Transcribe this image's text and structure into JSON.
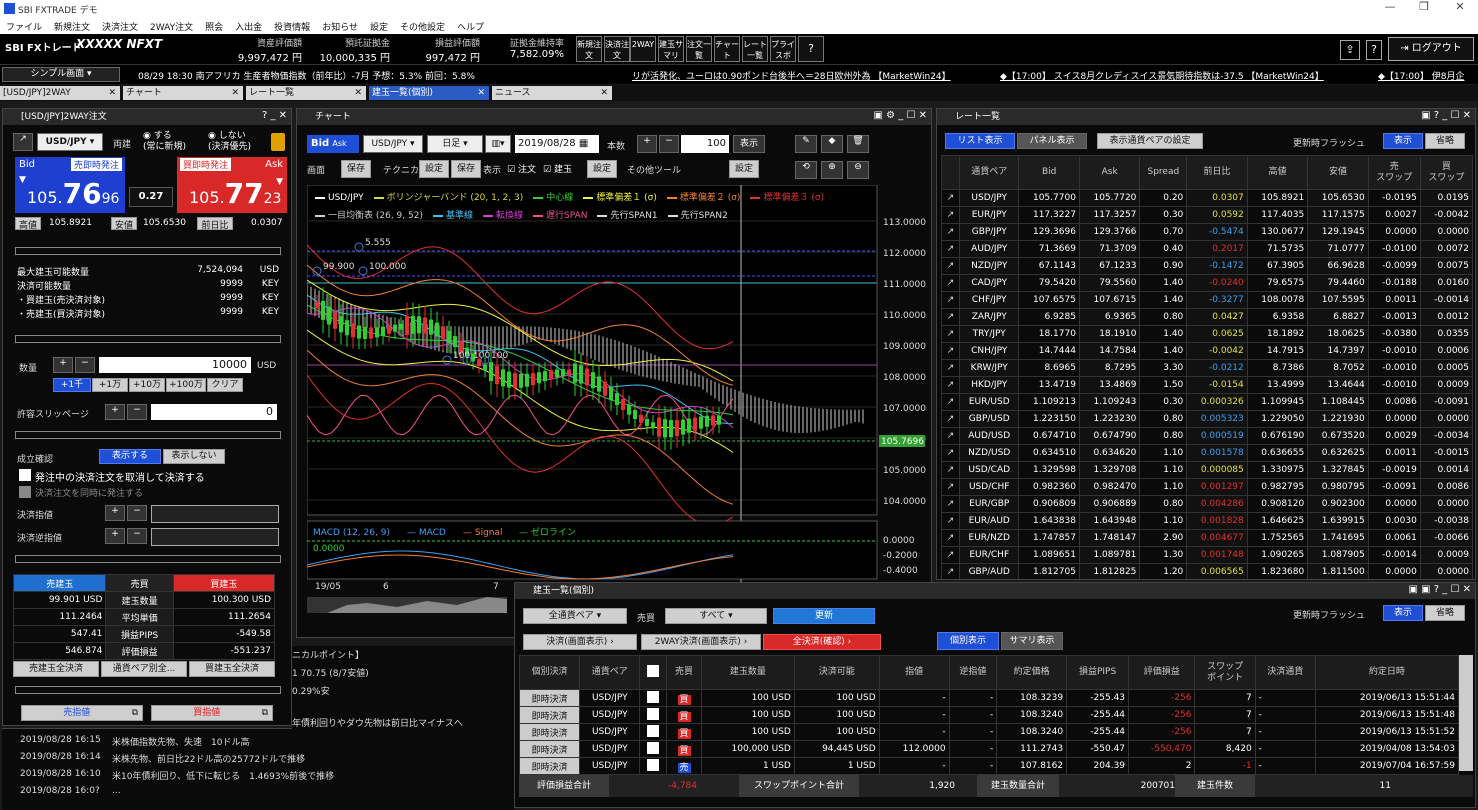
{
  "window": {
    "title": "SBI FXTRADE デモ",
    "min": "—",
    "max": "❐",
    "close": "✕"
  },
  "menu": [
    "ファイル",
    "新規注文",
    "決済注文",
    "2WAY注文",
    "照会",
    "入出金",
    "投資情報",
    "お知らせ",
    "設定",
    "その他設定",
    "ヘルプ"
  ],
  "header": {
    "logo": "SBI FXトレード",
    "account": "XXXXX NFXT",
    "stats": [
      {
        "k": "資産評価額",
        "v": "9,997,472 円"
      },
      {
        "k": "預託証拠金",
        "v": "10,000,335 円"
      },
      {
        "k": "損益評価額",
        "v": "997,472 円"
      },
      {
        "k": "証拠金維持率",
        "v": "7,582.09%"
      }
    ],
    "buttons": [
      "新規注文",
      "決済注文",
      "2WAY",
      "建玉サマリ",
      "注文一覧",
      "チャート",
      "レート一覧",
      "プライスボ",
      "?"
    ],
    "logout": "ログアウト"
  },
  "ticker": {
    "select": "シンプル画面",
    "item1": "08/29 18:30 南アフリカ 生産者物価指数（前年比）-7月 予想：5.3% 前回：5.8%",
    "item2": "リが活発化、ユーロは0.90ポンド台後半へ＝28日欧州外為 【MarketWin24】",
    "item3": "◆【17:00】 スイス8月クレディスイス景気期待指数は-37.5 【MarketWin24】",
    "item4": "◆【17:00】 伊8月企"
  },
  "tabs": [
    "[USD/JPY]2WAY",
    "チャート",
    "レート一覧",
    "建玉一覧(個別)",
    "ニュース"
  ],
  "order": {
    "title": "[USD/JPY]2WAY注文",
    "pair": "USD/JPY",
    "ryodate": "両建",
    "r1": "する\n(常に新規)",
    "r2": "しない\n(決済優先)",
    "bid_label": "Bid",
    "bid_btn": "売即時発注",
    "bid_big": "105.",
    "bid_mid": "76",
    "bid_small": "96",
    "ask_label": "Ask",
    "ask_btn": "買即時発注",
    "ask_big": "105.",
    "ask_mid": "77",
    "ask_small": "23",
    "spread": "0.27",
    "high_l": "高値",
    "high_v": "105.8921",
    "low_l": "安値",
    "low_v": "105.6530",
    "chg_l": "前日比",
    "chg_v": "0.0307",
    "rows": [
      [
        "最大建玉可能数量",
        "7,524,094",
        "USD"
      ],
      [
        "決済可能数量",
        "9999",
        "KEY"
      ],
      [
        "・買建玉(売決済対象)",
        "9999",
        "KEY"
      ],
      [
        "・売建玉(買決済対象)",
        "9999",
        "KEY"
      ]
    ],
    "qty_l": "数量",
    "qty_v": "10000",
    "qty_u": "USD",
    "qbtns": [
      "+1千",
      "+1万",
      "+10万",
      "+100万",
      "クリア"
    ],
    "slip_l": "許容スリッページ",
    "slip_v": "0",
    "conf_l": "成立確認",
    "conf_on": "表示する",
    "conf_off": "表示しない",
    "cb1": "発注中の決済注文を取消して決済する",
    "cb2": "決済注文を同時に発注する",
    "stop1": "決済指値",
    "stop2": "決済逆指値",
    "pos_h": [
      "売建玉",
      "売買",
      "買建玉"
    ],
    "pos": [
      [
        "99.901 USD",
        "建玉数量",
        "100.300 USD"
      ],
      [
        "111.2464",
        "平均単価",
        "111.2654"
      ],
      [
        "547.41",
        "損益PIPS",
        "-549.58"
      ],
      [
        "546.874",
        "評価損益",
        "-551.237"
      ]
    ],
    "pos_btns": [
      "売建玉全決済",
      "通貨ペア別全...",
      "買建玉全決済"
    ],
    "limit_sell": "売指値",
    "limit_buy": "買指値"
  },
  "news": {
    "items": [
      [
        "2019/08/28 16:15",
        "米株価指数先物、失速　10ドル高"
      ],
      [
        "2019/08/28 16:14",
        "米株先物、前日比22ドル高の25772ドルで推移"
      ],
      [
        "2019/08/28 16:10",
        "米10年債利回り、低下に転じる　1.4693%前後で推移"
      ],
      [
        "2019/08/28 16:0?",
        "..."
      ]
    ],
    "partial": [
      "ニカルポイント】",
      "1  70.75 (8/7安値)",
      "0.29%安",
      "年債利回りやダウ先物は前日比マイナスへ"
    ]
  },
  "chart": {
    "title": "チャート",
    "bid": "Bid",
    "ask": "Ask",
    "pair": "USD/JPY",
    "period": "日足",
    "date": "2019/08/28",
    "count_l": "本数",
    "count": "100",
    "show": "表示",
    "row2": [
      "画面",
      "保存",
      "テクニカル",
      "設定",
      "保存",
      "表示",
      "注文",
      "建玉",
      "設定",
      "その他ツール",
      "設定"
    ],
    "legend": [
      [
        "USD/JPY",
        "#fff"
      ],
      [
        "ボリンジャーバンド (20, 1, 2, 3)",
        "#d9d940"
      ],
      [
        "中心線",
        "#30d030"
      ],
      [
        "標準偏差１ (σ)",
        "#f0f040"
      ],
      [
        "標準偏差２ (σ)",
        "#f08030"
      ],
      [
        "標準偏差３ (σ)",
        "#e03030"
      ],
      [
        "一目均衡表 (26, 9, 52)",
        "#ccc"
      ],
      [
        "基準線",
        "#40c0f0"
      ],
      [
        "転換線",
        "#d040d0"
      ],
      [
        "遅行SPAN",
        "#f05090"
      ],
      [
        "先行SPAN1",
        "#ddd"
      ],
      [
        "先行SPAN2",
        "#ddd"
      ]
    ],
    "price_labels": [
      "113.0000",
      "112.0000",
      "111.0000",
      "110.0000",
      "109.0000",
      "108.0000",
      "107.0000",
      "106.0000",
      "105.0000",
      "104.0000"
    ],
    "current": "105.7696",
    "ann1": "5.555",
    "ann2": "99.900",
    "ann3": "100.000",
    "ann4": "100",
    "ann5": "100",
    "ann6": "100",
    "macd_legend": [
      "MACD (12, 26, 9)",
      "MACD",
      "Signal",
      "ゼロライン"
    ],
    "macd_val": "0.0000",
    "macd_labels": [
      "0.0000",
      "-0.2000",
      "-0.4000"
    ],
    "xlabels": [
      "19/05",
      "6",
      "7"
    ]
  },
  "rates": {
    "title": "レート一覧",
    "list": "リスト表示",
    "panel": "パネル表示",
    "setpair": "表示通貨ペアの設定",
    "flash": "更新時フラッシュ",
    "on": "表示",
    "off": "省略",
    "head": [
      "通貨ペア",
      "Bid",
      "Ask",
      "Spread",
      "前日比",
      "高値",
      "安値",
      "売\nスワップ",
      "買\nスワップ"
    ],
    "rows": [
      [
        "USD/JPY",
        "105.7700",
        "105.7720",
        "0.20",
        "0.0307",
        "105.8921",
        "105.6530",
        "-0.0195",
        "0.0195",
        "u"
      ],
      [
        "EUR/JPY",
        "117.3227",
        "117.3257",
        "0.30",
        "0.0592",
        "117.4035",
        "117.1575",
        "0.0027",
        "-0.0042",
        "u"
      ],
      [
        "GBP/JPY",
        "129.3696",
        "129.3766",
        "0.70",
        "-0.5474",
        "130.0677",
        "129.1945",
        "0.0000",
        "0.0000",
        "b"
      ],
      [
        "AUD/JPY",
        "71.3669",
        "71.3709",
        "0.40",
        "0.2017",
        "71.5735",
        "71.0777",
        "-0.0100",
        "0.0072",
        "d"
      ],
      [
        "NZD/JPY",
        "67.1143",
        "67.1233",
        "0.90",
        "-0.1472",
        "67.3905",
        "66.9628",
        "-0.0099",
        "0.0075",
        "b"
      ],
      [
        "CAD/JPY",
        "79.5420",
        "79.5560",
        "1.40",
        "-0.0240",
        "79.6575",
        "79.4460",
        "-0.0188",
        "0.0160",
        "d"
      ],
      [
        "CHF/JPY",
        "107.6575",
        "107.6715",
        "1.40",
        "-0.3277",
        "108.0078",
        "107.5595",
        "0.0011",
        "-0.0014",
        "b"
      ],
      [
        "ZAR/JPY",
        "6.9285",
        "6.9365",
        "0.80",
        "0.0427",
        "6.9358",
        "6.8827",
        "-0.0013",
        "0.0012",
        "u"
      ],
      [
        "TRY/JPY",
        "18.1770",
        "18.1910",
        "1.40",
        "0.0625",
        "18.1892",
        "18.0625",
        "-0.0380",
        "0.0355",
        "u"
      ],
      [
        "CNH/JPY",
        "14.7444",
        "14.7584",
        "1.40",
        "-0.0042",
        "14.7915",
        "14.7397",
        "-0.0010",
        "0.0006",
        "u"
      ],
      [
        "KRW/JPY",
        "8.6965",
        "8.7295",
        "3.30",
        "-0.0212",
        "8.7386",
        "8.7052",
        "-0.0010",
        "0.0005",
        "b"
      ],
      [
        "HKD/JPY",
        "13.4719",
        "13.4869",
        "1.50",
        "-0.0154",
        "13.4999",
        "13.4644",
        "-0.0010",
        "0.0009",
        "u"
      ],
      [
        "EUR/USD",
        "1.109213",
        "1.109243",
        "0.30",
        "0.000326",
        "1.109945",
        "1.108445",
        "0.0086",
        "-0.0091",
        "u"
      ],
      [
        "GBP/USD",
        "1.223150",
        "1.223230",
        "0.80",
        "0.005323",
        "1.229050",
        "1.221930",
        "0.0000",
        "0.0000",
        "b"
      ],
      [
        "AUD/USD",
        "0.674710",
        "0.674790",
        "0.80",
        "0.000519",
        "0.676190",
        "0.673520",
        "0.0029",
        "-0.0034",
        "b"
      ],
      [
        "NZD/USD",
        "0.634510",
        "0.634620",
        "1.10",
        "0.001578",
        "0.636655",
        "0.632625",
        "0.0011",
        "-0.0015",
        "b"
      ],
      [
        "USD/CAD",
        "1.329598",
        "1.329708",
        "1.10",
        "0.000085",
        "1.330975",
        "1.327845",
        "-0.0019",
        "0.0014",
        "u"
      ],
      [
        "USD/CHF",
        "0.982360",
        "0.982470",
        "1.10",
        "0.001297",
        "0.982795",
        "0.980795",
        "-0.0091",
        "0.0086",
        "d"
      ],
      [
        "EUR/GBP",
        "0.906809",
        "0.906889",
        "0.80",
        "0.004286",
        "0.908120",
        "0.902300",
        "0.0000",
        "0.0000",
        "d"
      ],
      [
        "EUR/AUD",
        "1.643838",
        "1.643948",
        "1.10",
        "0.001828",
        "1.646625",
        "1.639915",
        "0.0030",
        "-0.0038",
        "d"
      ],
      [
        "EUR/NZD",
        "1.747857",
        "1.748147",
        "2.90",
        "0.004677",
        "1.752565",
        "1.741695",
        "0.0061",
        "-0.0066",
        "d"
      ],
      [
        "EUR/CHF",
        "1.089651",
        "1.089781",
        "1.30",
        "0.001748",
        "1.090265",
        "1.087905",
        "-0.0014",
        "0.0009",
        "d"
      ],
      [
        "GBP/AUD",
        "1.812705",
        "1.812825",
        "1.20",
        "0.006565",
        "1.823680",
        "1.811500",
        "0.0000",
        "0.0000",
        "u"
      ]
    ]
  },
  "positions": {
    "title": "建玉一覧(個別)",
    "pairsel": "全通貨ペア",
    "side_l": "売買",
    "sidesel": "すべて",
    "update": "更新",
    "b1": "決済(画面表示)",
    "b2": "2WAY決済(画面表示)",
    "b3": "全決済(確認)",
    "v1": "個別表示",
    "v2": "サマリ表示",
    "flash": "更新時フラッシュ",
    "on": "表示",
    "off": "省略",
    "head": [
      "個別決済",
      "通貨ペア",
      "",
      "売買",
      "建玉数量",
      "決済可能",
      "指値",
      "逆指値",
      "約定価格",
      "損益PIPS",
      "評価損益",
      "スワップ\nポイント",
      "決済通貨",
      "約定日時"
    ],
    "rows": [
      [
        "即時決済",
        "USD/JPY",
        "買",
        "100 USD",
        "100 USD",
        "-",
        "-",
        "108.3239",
        "-255.43",
        "-256",
        "7",
        "-",
        "2019/06/13 15:51:44"
      ],
      [
        "即時決済",
        "USD/JPY",
        "買",
        "100 USD",
        "100 USD",
        "-",
        "-",
        "108.3240",
        "-255.44",
        "-256",
        "7",
        "-",
        "2019/06/13 15:51:48"
      ],
      [
        "即時決済",
        "USD/JPY",
        "買",
        "100 USD",
        "100 USD",
        "-",
        "-",
        "108.3240",
        "-255.44",
        "-256",
        "7",
        "-",
        "2019/06/13 15:51:52"
      ],
      [
        "即時決済",
        "USD/JPY",
        "買",
        "100,000 USD",
        "94,445 USD",
        "112.0000",
        "-",
        "111.2743",
        "-550.47",
        "-550,470",
        "8,420",
        "-",
        "2019/04/08 13:54:03"
      ],
      [
        "即時決済",
        "USD/JPY",
        "売",
        "1 USD",
        "1 USD",
        "-",
        "-",
        "107.8162",
        "204.39",
        "2",
        "-1",
        "-",
        "2019/07/04 16:57:59"
      ]
    ],
    "foot": [
      [
        "評価損益合計",
        "-4,784"
      ],
      [
        "スワップポイント合計",
        "1,920"
      ],
      [
        "建玉数量合計",
        "200701"
      ],
      [
        "建玉件数",
        "11"
      ]
    ]
  }
}
